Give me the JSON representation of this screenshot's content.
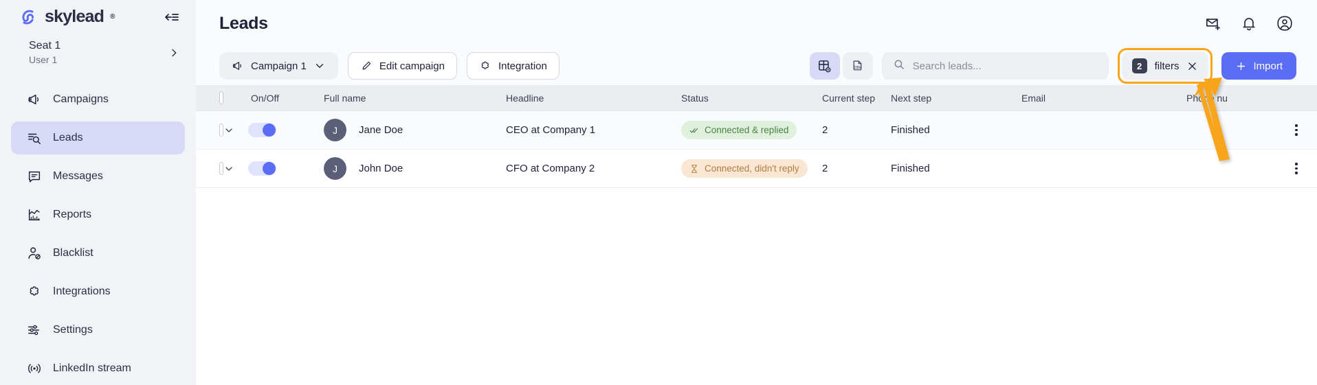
{
  "sidebar": {
    "logo": {
      "text": "skylead",
      "registered": "®",
      "icon": "skylead-logo-icon"
    },
    "collapse_icon": "collapse-sidebar-icon",
    "seat": {
      "name": "Seat 1",
      "user": "User 1",
      "chevron": "chevron-right-icon"
    },
    "items": [
      {
        "label": "Campaigns",
        "icon": "megaphone-icon",
        "active": false
      },
      {
        "label": "Leads",
        "icon": "leads-search-icon",
        "active": true
      },
      {
        "label": "Messages",
        "icon": "message-bubble-icon",
        "active": false
      },
      {
        "label": "Reports",
        "icon": "chart-icon",
        "active": false
      },
      {
        "label": "Blacklist",
        "icon": "user-blocked-icon",
        "active": false
      },
      {
        "label": "Integrations",
        "icon": "puzzle-icon",
        "active": false
      },
      {
        "label": "Settings",
        "icon": "sliders-icon",
        "active": false
      },
      {
        "label": "LinkedIn stream",
        "icon": "broadcast-icon",
        "active": false
      }
    ]
  },
  "header": {
    "title": "Leads",
    "icons": [
      {
        "name": "mail-add-icon"
      },
      {
        "name": "bell-icon"
      },
      {
        "name": "account-circle-icon"
      }
    ]
  },
  "toolbar": {
    "campaign_select": {
      "label": "Campaign 1",
      "icon": "megaphone-icon",
      "chevron": "chevron-down-icon"
    },
    "edit_campaign": {
      "label": "Edit campaign",
      "icon": "pencil-icon"
    },
    "integration": {
      "label": "Integration",
      "icon": "puzzle-icon"
    },
    "view_table": {
      "name": "table-settings-icon",
      "active": true
    },
    "view_csv": {
      "name": "csv-file-icon",
      "active": false
    },
    "search": {
      "placeholder": "Search leads...",
      "value": "",
      "icon": "search-icon"
    },
    "filters": {
      "count": "2",
      "label": "filters",
      "clear_icon": "close-icon",
      "highlight_color": "#f8a51b"
    },
    "import": {
      "label": "Import",
      "icon": "plus-icon",
      "color": "#5b6cf5"
    }
  },
  "table": {
    "columns": [
      "On/Off",
      "Full name",
      "Headline",
      "Status",
      "Current step",
      "Next step",
      "Email",
      "Phone nu"
    ],
    "rows": [
      {
        "initial": "J",
        "full_name": "Jane Doe",
        "headline": "CEO at Company 1",
        "status": {
          "text": "Connected & replied",
          "tone": "green",
          "icon": "double-check-icon"
        },
        "current_step": "2",
        "next_step": "Finished",
        "email": "",
        "phone": "",
        "enabled": true
      },
      {
        "initial": "J",
        "full_name": "John Doe",
        "headline": "CFO at Company 2",
        "status": {
          "text": "Connected, didn't reply",
          "tone": "orange",
          "icon": "hourglass-icon"
        },
        "current_step": "2",
        "next_step": "Finished",
        "email": "",
        "phone": "",
        "enabled": true
      }
    ]
  },
  "annotation": {
    "arrow": {
      "color": "#f8a51b",
      "points_to": "filters-chip"
    }
  }
}
